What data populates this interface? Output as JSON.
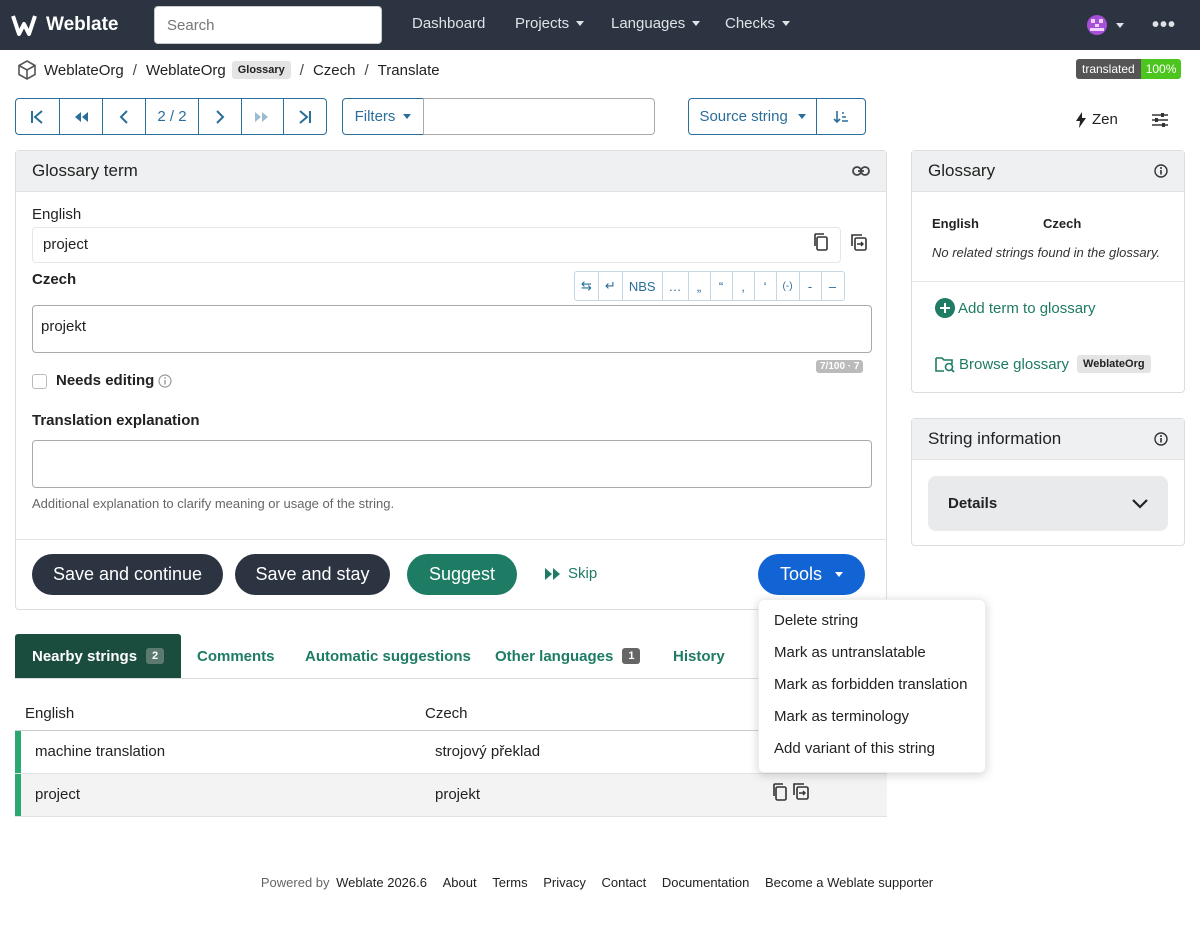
{
  "navbar": {
    "brand": "Weblate",
    "search_placeholder": "Search",
    "links": [
      "Dashboard",
      "Projects",
      "Languages",
      "Checks"
    ],
    "more_icon": "kebab-icon"
  },
  "breadcrumb": {
    "project": "WeblateOrg",
    "component": "WeblateOrg",
    "component_tag": "Glossary",
    "language": "Czech",
    "page": "Translate"
  },
  "status": {
    "label": "translated",
    "percent": "100%"
  },
  "toolbar": {
    "position": "2 / 2",
    "filters_label": "Filters",
    "sort_label": "Source string",
    "zen_label": "Zen"
  },
  "editor": {
    "title": "Glossary term",
    "source_lang": "English",
    "source_text": "project",
    "target_lang": "Czech",
    "target_text": "projekt",
    "chars": [
      "⇆",
      "↵",
      "NBS",
      "…",
      "„",
      "“",
      "‚",
      "‘",
      "(-)",
      "-",
      "–"
    ],
    "counter": "7/100 · 7",
    "needs_editing": "Needs editing",
    "explanation_label": "Translation explanation",
    "explanation_help": "Additional explanation to clarify meaning or usage of the string.",
    "buttons": {
      "save_continue": "Save and continue",
      "save_stay": "Save and stay",
      "suggest": "Suggest",
      "skip": "Skip",
      "tools": "Tools"
    }
  },
  "tools_menu": [
    "Delete string",
    "Mark as untranslatable",
    "Mark as forbidden translation",
    "Mark as terminology",
    "Add variant of this string"
  ],
  "tabs": [
    {
      "label": "Nearby strings",
      "count": "2"
    },
    {
      "label": "Comments"
    },
    {
      "label": "Automatic suggestions"
    },
    {
      "label": "Other languages",
      "count": "1"
    },
    {
      "label": "History"
    }
  ],
  "nearby": {
    "headers": [
      "English",
      "Czech"
    ],
    "rows": [
      {
        "source": "machine translation",
        "target": "strojový překlad"
      },
      {
        "source": "project",
        "target": "projekt"
      }
    ]
  },
  "glossary": {
    "title": "Glossary",
    "col_source": "English",
    "col_target": "Czech",
    "empty": "No related strings found in the glossary.",
    "add_term": "Add term to glossary",
    "browse": "Browse glossary",
    "browse_tag": "WeblateOrg"
  },
  "string_info": {
    "title": "String information",
    "details": "Details"
  },
  "footer": {
    "powered_prefix": "Powered by",
    "powered_link": "Weblate 2026.6",
    "links": [
      "About",
      "Terms",
      "Privacy",
      "Contact",
      "Documentation",
      "Become a Weblate supporter"
    ]
  },
  "colors": {
    "navbar": "#2b3440",
    "accent_green": "#1e7b64",
    "accent_blue": "#1264d4",
    "translated_green": "#4cc61e"
  }
}
